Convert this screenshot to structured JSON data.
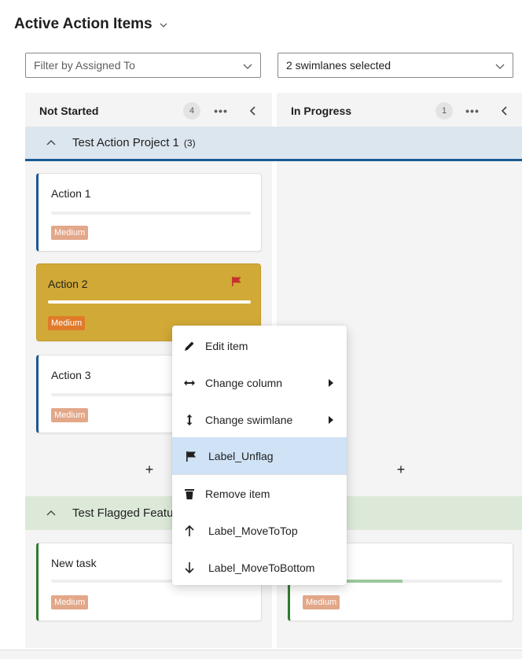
{
  "header": {
    "title": "Active Action Items"
  },
  "filters": {
    "assigned_placeholder": "Filter by Assigned To",
    "swimlanes_value": "2 swimlanes selected"
  },
  "columns": [
    {
      "name": "Not Started",
      "count": "4",
      "more": "•••"
    },
    {
      "name": "In Progress",
      "count": "1",
      "more": "•••"
    }
  ],
  "swimlanes": [
    {
      "name": "Test Action Project 1",
      "count": "(3)"
    },
    {
      "name": "Test Flagged Featur"
    }
  ],
  "cards": [
    {
      "title": "Action 1",
      "priority": "Medium"
    },
    {
      "title": "Action 2",
      "priority": "Medium",
      "flagged": true
    },
    {
      "title": "Action 3",
      "priority": "Medium"
    },
    {
      "title": "New task",
      "priority": "Medium"
    },
    {
      "title": "",
      "priority": "Medium",
      "progress": 0.5
    }
  ],
  "add_label": "+",
  "context_menu": [
    {
      "label": "Edit item",
      "icon": "pencil-icon"
    },
    {
      "label": "Change column",
      "icon": "arrows-horizontal-icon",
      "submenu": true
    },
    {
      "label": "Change swimlane",
      "icon": "arrows-vertical-icon",
      "submenu": true
    },
    {
      "label": "Label_Unflag",
      "icon": "flag-icon",
      "selected": true
    },
    {
      "label": "Remove item",
      "icon": "trash-icon"
    },
    {
      "label": "Label_MoveToTop",
      "icon": "arrow-up-icon"
    },
    {
      "label": "Label_MoveToBottom",
      "icon": "arrow-down-icon"
    }
  ],
  "colors": {
    "swimlane1_accent": "#1a5a92",
    "swimlane2_accent": "#2f7b2f",
    "flagged_card": "#d1a936",
    "priority_badge": "#e3a789",
    "menu_selected": "#cfe2f6",
    "flag_red": "#c4322c"
  }
}
